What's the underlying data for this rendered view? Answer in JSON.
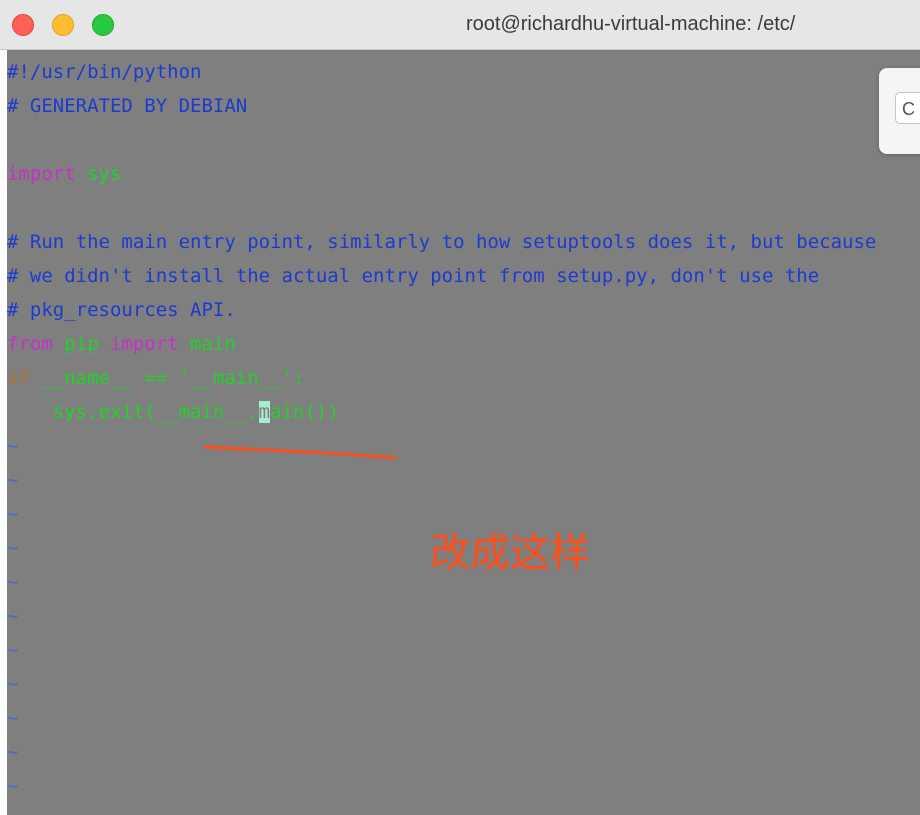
{
  "window": {
    "title": "root@richardhu-virtual-machine: /etc/"
  },
  "editor": {
    "lines": [
      {
        "spans": [
          {
            "text": "#!/usr/bin/python",
            "color": "#1d3ad0"
          }
        ]
      },
      {
        "spans": [
          {
            "text": "# GENERATED BY DEBIAN",
            "color": "#1d3ad0"
          }
        ]
      },
      {
        "spans": []
      },
      {
        "spans": [
          {
            "text": "import",
            "color": "#c530c8"
          },
          {
            "text": " sys",
            "color": "#22d22a"
          }
        ]
      },
      {
        "spans": []
      },
      {
        "spans": [
          {
            "text": "# Run the main entry point, similarly to how setuptools does it, but because",
            "color": "#1d3ad0"
          }
        ]
      },
      {
        "spans": [
          {
            "text": "# we didn't install the actual entry point from setup.py, don't use the",
            "color": "#1d3ad0"
          }
        ]
      },
      {
        "spans": [
          {
            "text": "# pkg_resources API.",
            "color": "#1d3ad0"
          }
        ]
      },
      {
        "spans": [
          {
            "text": "from",
            "color": "#c530c8"
          },
          {
            "text": " pip ",
            "color": "#22d22a"
          },
          {
            "text": "import",
            "color": "#c530c8"
          },
          {
            "text": " main",
            "color": "#22d22a"
          }
        ]
      },
      {
        "spans": [
          {
            "text": "if",
            "color": "#b8702a"
          },
          {
            "text": " __name__ == '__main__':",
            "color": "#22d22a"
          }
        ]
      },
      {
        "spans": [
          {
            "text": "    sys.exit(__main__.",
            "color": "#22d22a"
          },
          {
            "text": "m",
            "color": "#7f7f7f",
            "cursor": true
          },
          {
            "text": "ain())",
            "color": "#22d22a"
          }
        ]
      }
    ],
    "tilde_char": "~",
    "tilde_count": 11
  },
  "find_popup": {
    "field_text": "C"
  },
  "annotation": {
    "text": "改成这样",
    "color": "#ff4d1a"
  }
}
